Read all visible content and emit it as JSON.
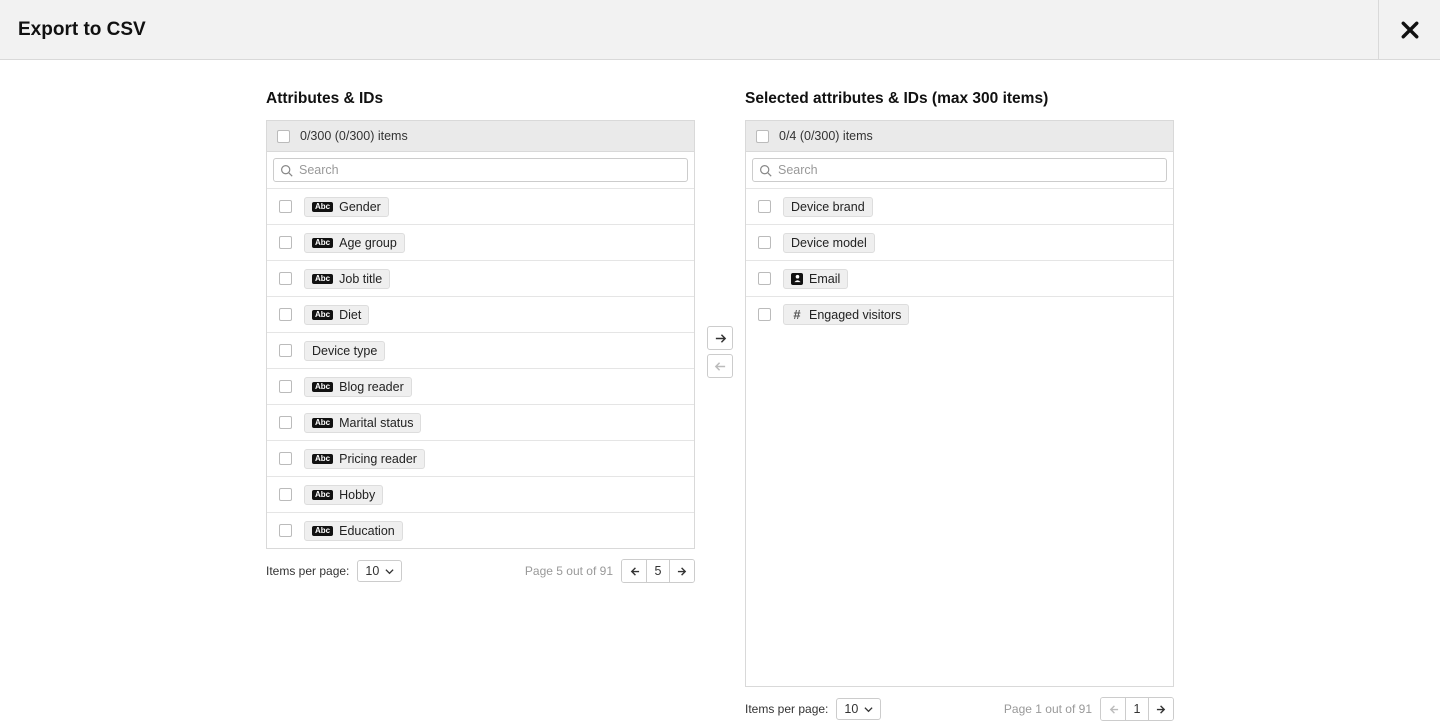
{
  "header": {
    "title": "Export to CSV"
  },
  "left": {
    "title": "Attributes & IDs",
    "select_all": "0/300 (0/300) items",
    "search_placeholder": "Search",
    "items": [
      {
        "icon": "abc",
        "label": "Gender"
      },
      {
        "icon": "abc",
        "label": "Age group"
      },
      {
        "icon": "abc",
        "label": "Job title"
      },
      {
        "icon": "abc",
        "label": "Diet"
      },
      {
        "icon": "none",
        "label": "Device type"
      },
      {
        "icon": "abc",
        "label": "Blog reader"
      },
      {
        "icon": "abc",
        "label": "Marital status"
      },
      {
        "icon": "abc",
        "label": "Pricing reader"
      },
      {
        "icon": "abc",
        "label": "Hobby"
      },
      {
        "icon": "abc",
        "label": "Education"
      }
    ],
    "items_per_page_label": "Items per page:",
    "items_per_page_value": "10",
    "page_info": "Page 5 out of 91",
    "current_page": "5"
  },
  "right": {
    "title": "Selected attributes & IDs (max 300 items)",
    "select_all": "0/4 (0/300) items",
    "search_placeholder": "Search",
    "items": [
      {
        "icon": "none",
        "label": "Device brand"
      },
      {
        "icon": "none",
        "label": "Device model"
      },
      {
        "icon": "person",
        "label": "Email"
      },
      {
        "icon": "hash",
        "label": "Engaged visitors"
      }
    ],
    "items_per_page_label": "Items per page:",
    "items_per_page_value": "10",
    "page_info": "Page 1 out of 91",
    "current_page": "1"
  }
}
